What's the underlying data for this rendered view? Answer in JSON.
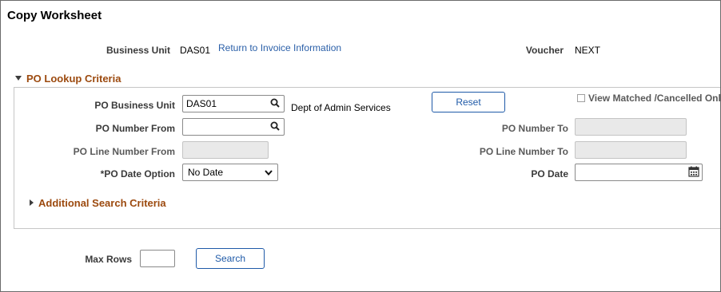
{
  "page": {
    "title": "Copy Worksheet"
  },
  "header": {
    "business_unit_label": "Business Unit",
    "business_unit_value": "DAS01",
    "return_link": "Return to Invoice Information",
    "voucher_label": "Voucher",
    "voucher_value": "NEXT"
  },
  "po_lookup": {
    "section_title": "PO Lookup Criteria",
    "po_business_unit_label": "PO Business Unit",
    "po_business_unit_value": "DAS01",
    "po_business_unit_desc": "Dept of Admin Services",
    "reset_label": "Reset",
    "view_matched_label": "View Matched /Cancelled Only",
    "view_matched_checked": false,
    "po_number_from_label": "PO Number From",
    "po_number_from_value": "",
    "po_number_to_label": "PO Number To",
    "po_number_to_value": "",
    "po_line_from_label": "PO Line Number From",
    "po_line_from_value": "",
    "po_line_to_label": "PO Line Number To",
    "po_line_to_value": "",
    "po_date_option_label": "*PO Date Option",
    "po_date_option_value": "No Date",
    "po_date_label": "PO Date",
    "po_date_value": "",
    "additional_title": "Additional Search Criteria"
  },
  "footer": {
    "max_rows_label": "Max Rows",
    "max_rows_value": "",
    "search_label": "Search"
  },
  "icons": {
    "expanded": "triangle-down-icon",
    "collapsed": "triangle-right-icon",
    "lookup": "search-icon",
    "dropdown": "chevron-down-icon",
    "calendar": "calendar-icon"
  },
  "colors": {
    "section_title": "#9c4a0f",
    "link": "#2a5fa8",
    "button_border": "#1f5aa8",
    "disabled_field": "#e9e9e9"
  }
}
